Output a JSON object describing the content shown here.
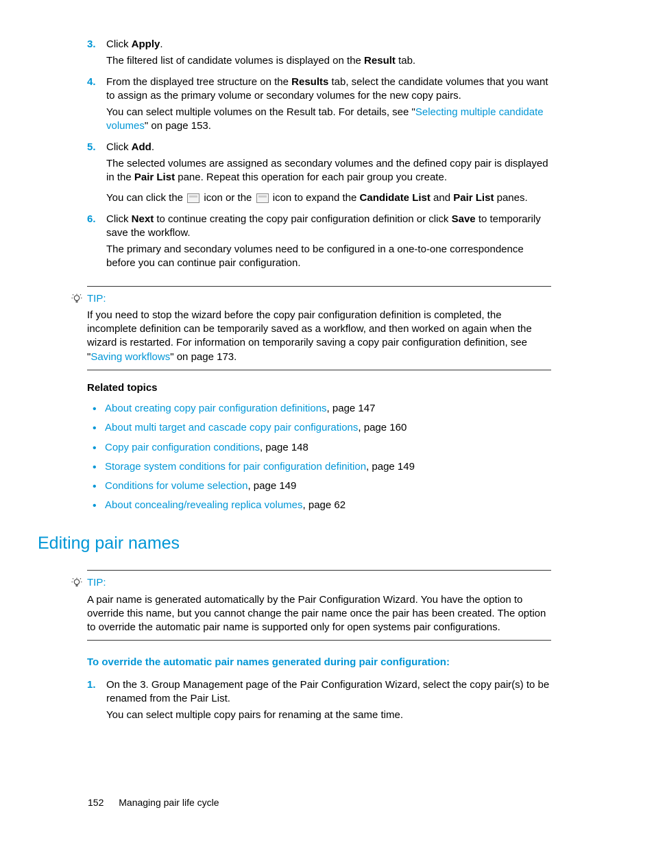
{
  "steps_a": {
    "s3": {
      "num": "3.",
      "line": "Click ",
      "bold": "Apply",
      "after": ".",
      "p1a": "The filtered list of candidate volumes is displayed on the ",
      "p1b": "Result",
      "p1c": " tab."
    },
    "s4": {
      "num": "4.",
      "line_a": "From the displayed tree structure on the ",
      "line_b": "Results",
      "line_c": " tab, select the candidate volumes that you want to assign as the primary volume or secondary volumes for the new copy pairs.",
      "p1a": "You can select multiple volumes on the Result tab. For details, see \"",
      "link": "Selecting multiple candidate volumes",
      "p1b": "\" on page 153."
    },
    "s5": {
      "num": "5.",
      "line": "Click ",
      "bold": "Add",
      "after": ".",
      "p1a": "The selected volumes are assigned as secondary volumes and the defined copy pair is displayed in the ",
      "p1b": "Pair List",
      "p1c": " pane. Repeat this operation for each pair group you create.",
      "p2a": "You can click the ",
      "p2b": " icon or the ",
      "p2c": " icon to expand the ",
      "p2d": "Candidate List",
      "p2e": " and ",
      "p2f": "Pair List",
      "p2g": " panes."
    },
    "s6": {
      "num": "6.",
      "line_a": "Click ",
      "line_b": "Next",
      "line_c": " to continue creating the copy pair configuration definition or click ",
      "line_d": "Save",
      "line_e": " to temporarily save the workflow.",
      "p1": "The primary and secondary volumes need to be configured in a one-to-one correspondence before you can continue pair configuration."
    }
  },
  "tip1": {
    "label": "TIP:",
    "body_a": "If you need to stop the wizard before the copy pair configuration definition is completed, the incomplete definition can be temporarily saved as a workflow, and then worked on again when the wizard is restarted. For information on temporarily saving a copy pair configuration definition, see \"",
    "link": "Saving workflows",
    "body_b": "\" on page 173."
  },
  "related": {
    "title": "Related topics",
    "items": [
      {
        "link": "About creating copy pair configuration definitions",
        "suffix": ", page 147"
      },
      {
        "link": "About multi target and cascade copy pair configurations",
        "suffix": ", page 160"
      },
      {
        "link": "Copy pair configuration conditions",
        "suffix": ", page 148"
      },
      {
        "link": "Storage system conditions for pair configuration definition",
        "suffix": ", page 149"
      },
      {
        "link": "Conditions for volume selection",
        "suffix": ", page 149"
      },
      {
        "link": "About concealing/revealing replica volumes",
        "suffix": ", page 62"
      }
    ]
  },
  "section2": {
    "heading": "Editing pair names"
  },
  "tip2": {
    "label": "TIP:",
    "body": "A pair name is generated automatically by the Pair Configuration Wizard. You have the option to override this name, but you cannot change the pair name once the pair has been created. The option to override the automatic pair name is supported only for open systems pair configurations."
  },
  "proc2": {
    "title": "To override the automatic pair names generated during pair configuration:",
    "s1": {
      "num": "1.",
      "line": "On the 3. Group Management page of the Pair Configuration Wizard, select the copy pair(s) to be renamed from the Pair List.",
      "p1": "You can select multiple copy pairs for renaming at the same time."
    }
  },
  "footer": {
    "page": "152",
    "chapter": "Managing pair life cycle"
  }
}
